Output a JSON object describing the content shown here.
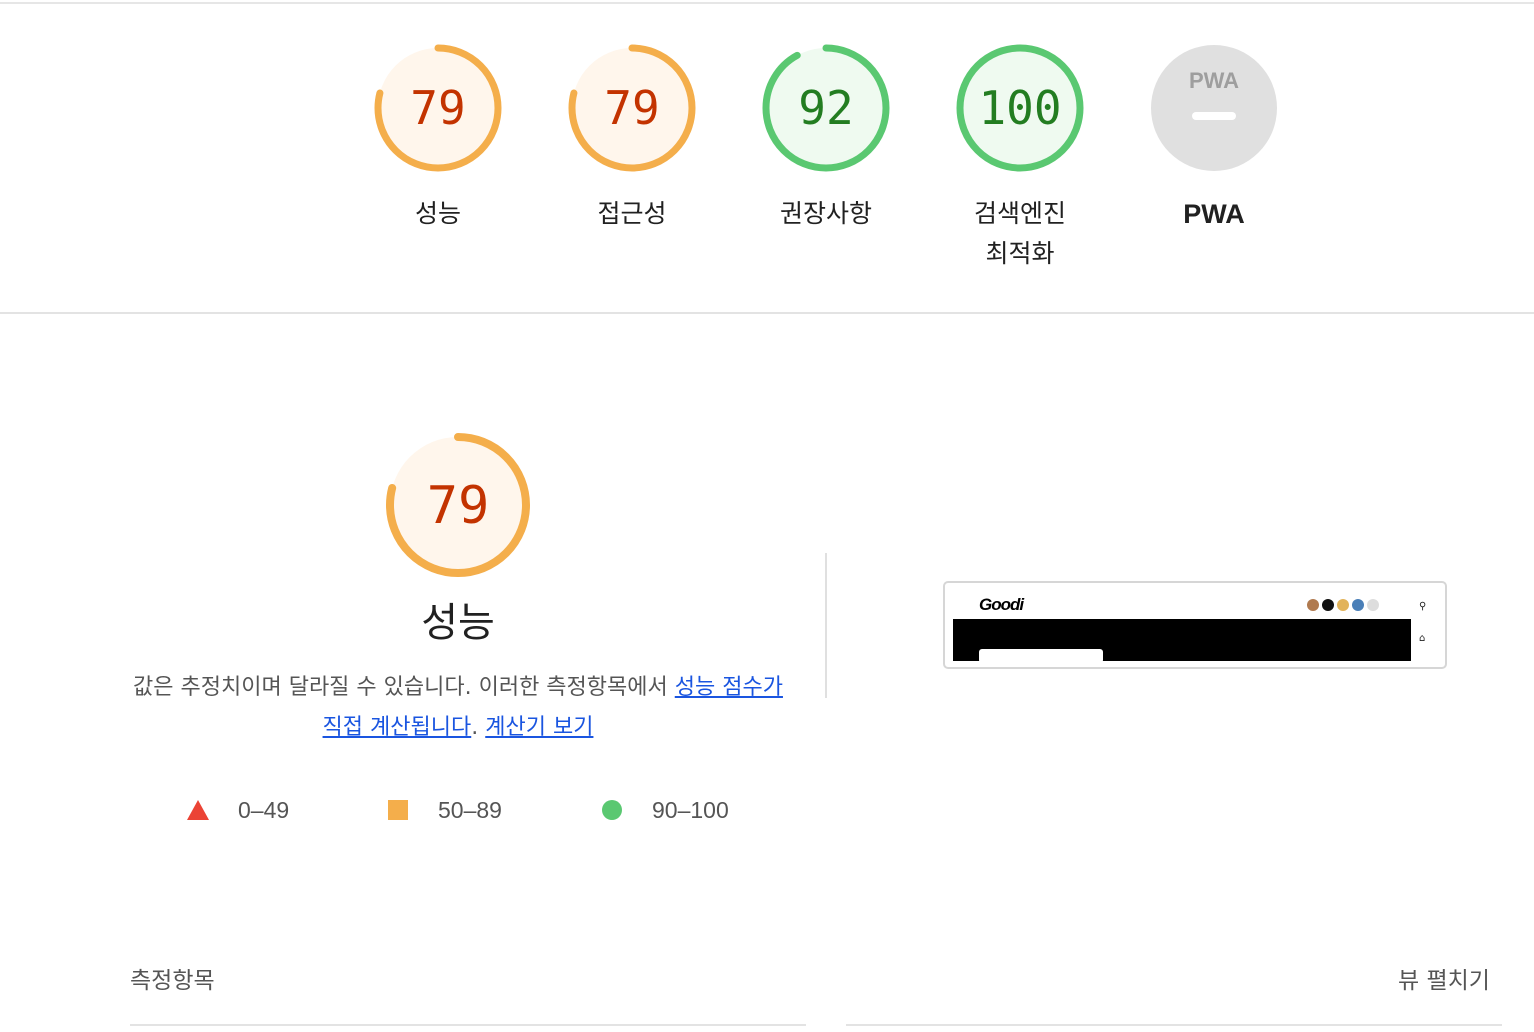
{
  "colors": {
    "average": "#f4ae4b",
    "average_text": "#c33300",
    "average_fill": "#fff6ec",
    "pass": "#5ac871",
    "pass_text": "#237d21",
    "pass_fill": "#effaf0",
    "fail": "#eb4335",
    "pwa_gray": "#e0e0e0",
    "link": "#1a55e0"
  },
  "gauges": [
    {
      "score": "79",
      "value": 79,
      "label": "성능",
      "status": "average"
    },
    {
      "score": "79",
      "value": 79,
      "label": "접근성",
      "status": "average"
    },
    {
      "score": "92",
      "value": 92,
      "label": "권장사항",
      "status": "pass"
    },
    {
      "score": "100",
      "value": 100,
      "label": "검색엔진\n최적화",
      "status": "pass"
    },
    {
      "score": "",
      "label": "PWA",
      "badge_text": "PWA",
      "status": "pwa"
    }
  ],
  "performance": {
    "score": "79",
    "value": 79,
    "title": "성능",
    "desc_prefix": "값은 추정치이며 달라질 수 있습니다. 이러한 측정항목에서 ",
    "link_score_calc": "성능 점수가 직접 계산됩니다",
    "desc_sep": ". ",
    "link_calculator": "계산기 보기"
  },
  "legend": [
    {
      "range": "0–49",
      "shape": "triangle"
    },
    {
      "range": "50–89",
      "shape": "square"
    },
    {
      "range": "90–100",
      "shape": "circle"
    }
  ],
  "screenshot_thumb": {
    "logo_text": "Goodi"
  },
  "metrics": {
    "title": "측정항목",
    "expand_label": "뷰 펼치기"
  }
}
